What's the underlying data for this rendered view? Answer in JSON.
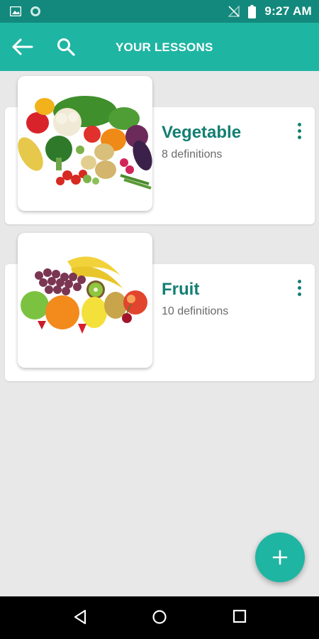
{
  "status_bar": {
    "time": "9:27 AM",
    "icons": [
      "image-icon",
      "circle-status-icon",
      "no-signal-icon",
      "battery-icon"
    ]
  },
  "app_bar": {
    "title": "YOUR LESSONS",
    "back_icon": "arrow-left-icon",
    "search_icon": "search-icon"
  },
  "lessons": [
    {
      "title": "Vegetable",
      "subtitle": "8 definitions",
      "image": "vegetables-photo",
      "menu_icon": "more-vert-icon"
    },
    {
      "title": "Fruit",
      "subtitle": "10 definitions",
      "image": "fruits-photo",
      "menu_icon": "more-vert-icon"
    }
  ],
  "fab": {
    "icon": "plus-icon"
  },
  "nav_bar": {
    "icons": [
      "back-triangle-icon",
      "home-circle-icon",
      "recents-square-icon"
    ]
  },
  "colors": {
    "primary": "#1fb5a3",
    "primary_dark": "#12897c",
    "accent_text": "#137f72",
    "background": "#e8e8e8"
  }
}
